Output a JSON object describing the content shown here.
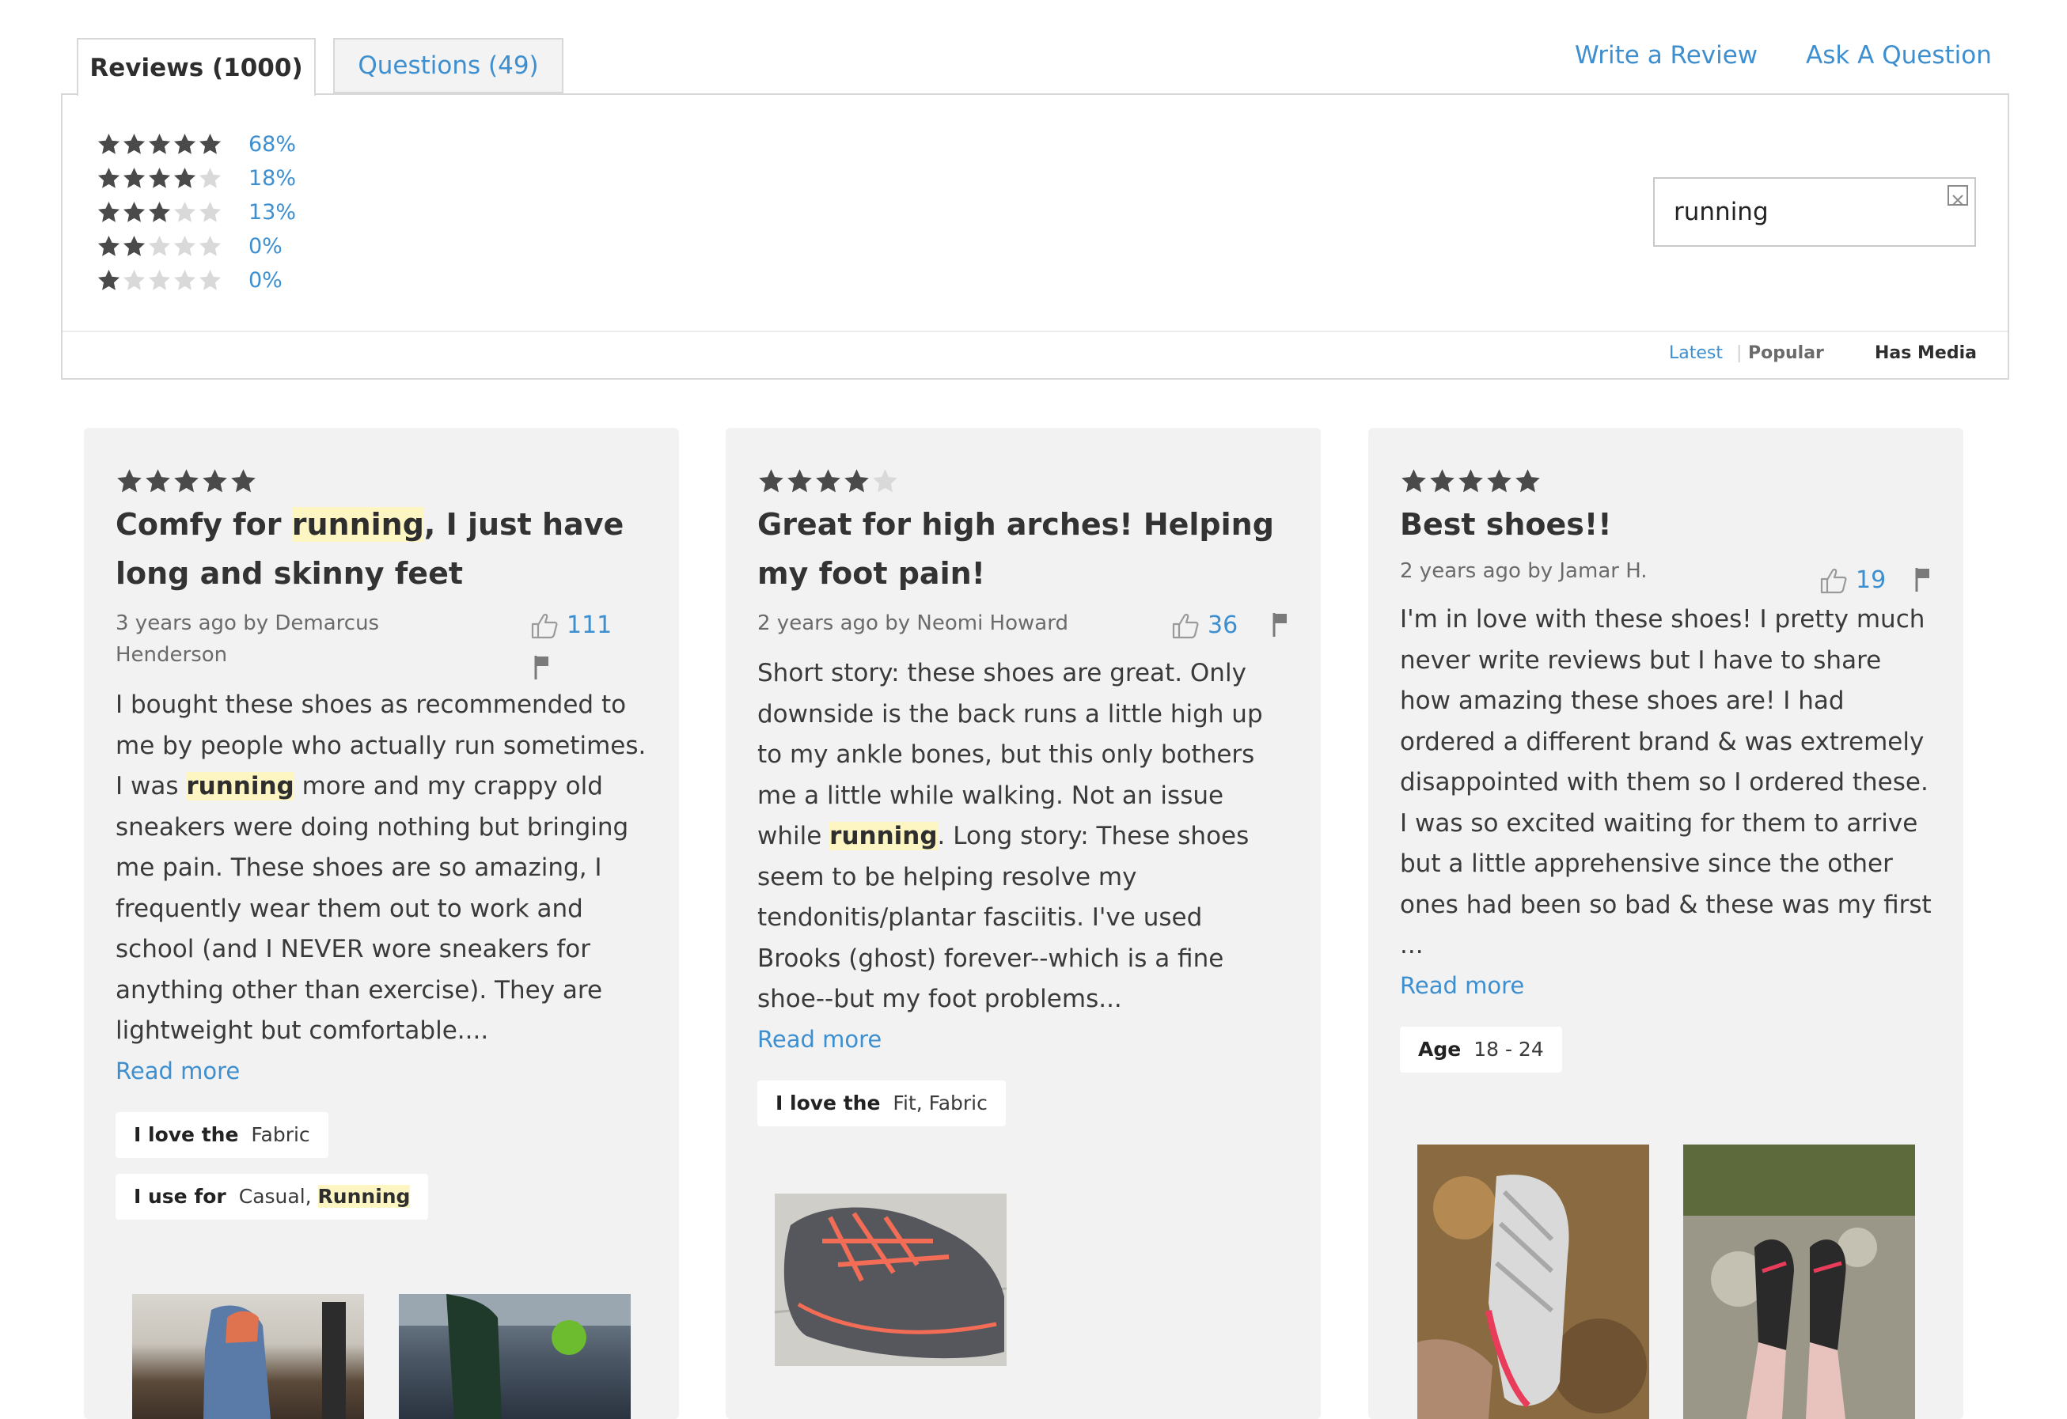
{
  "tabs": {
    "reviews": "Reviews (1000)",
    "questions": "Questions (49)"
  },
  "links": {
    "write_review": "Write a Review",
    "ask_question": "Ask A Question"
  },
  "histogram": [
    {
      "stars": 5,
      "percent": "68%"
    },
    {
      "stars": 4,
      "percent": "18%"
    },
    {
      "stars": 3,
      "percent": "13%"
    },
    {
      "stars": 2,
      "percent": "0%"
    },
    {
      "stars": 1,
      "percent": "0%"
    }
  ],
  "search": {
    "value": "running"
  },
  "filters": {
    "latest": "Latest",
    "popular": "Popular",
    "has_media": "Has Media"
  },
  "colors": {
    "accent": "#3d8fd0",
    "star": "#4a4a4a",
    "star_empty": "#d9d9d9",
    "highlight": "#fdf6c3",
    "card_bg": "#f2f2f2"
  },
  "reviews": [
    {
      "rating": 5,
      "title": {
        "pre": "Comfy for ",
        "hl": "running",
        "post": ", I just have long and skinny feet"
      },
      "meta": "3 years ago by Demarcus Henderson",
      "votes": "111",
      "body": {
        "p1": "I bought these shoes as recommended to me by people who actually run sometimes. I was ",
        "hl": "running",
        "p2": " more and my crappy old sneakers were doing nothing but bringing me pain. These shoes are so amazing, I frequently wear them out to work and school (and I NEVER wore sneakers for anything other than exercise). They are lightweight but comfortable...."
      },
      "read_more": "Read more",
      "chips": {
        "love_label": "I love the",
        "love_value": "Fabric",
        "use_label": "I use for",
        "use_value": "Casual, ",
        "use_hl": "Running"
      }
    },
    {
      "rating": 4,
      "title": {
        "text": "Great for high arches! Helping my foot pain!"
      },
      "meta": "2 years ago by Neomi Howard",
      "votes": "36",
      "body": {
        "p1": "Short story: these shoes are great. Only downside is the back runs a little high up to my ankle bones, but this only bothers me a little while walking. Not an issue while ",
        "hl": "running",
        "p2": ". Long story: These shoes seem to be helping resolve my tendonitis/plantar fasciitis. I've used Brooks (ghost) forever--which is a fine shoe--but my foot problems..."
      },
      "read_more": "Read more",
      "chips": {
        "love_label": "I love the",
        "love_value": "Fit, Fabric"
      }
    },
    {
      "rating": 5,
      "title": {
        "text": "Best shoes!!"
      },
      "meta": "2 years ago by Jamar H.",
      "votes": "19",
      "body": {
        "p1": "I'm in love with these shoes! I pretty much never write reviews but I have to share how amazing these shoes are! I had ordered a different brand & was extremely disappointed with them so I ordered these. I was so excited waiting for them to arrive but a little apprehensive since the other ones had been so bad & these was my first ..."
      },
      "read_more": "Read more",
      "chips": {
        "age_label": "Age",
        "age_value": "18 - 24"
      }
    }
  ]
}
